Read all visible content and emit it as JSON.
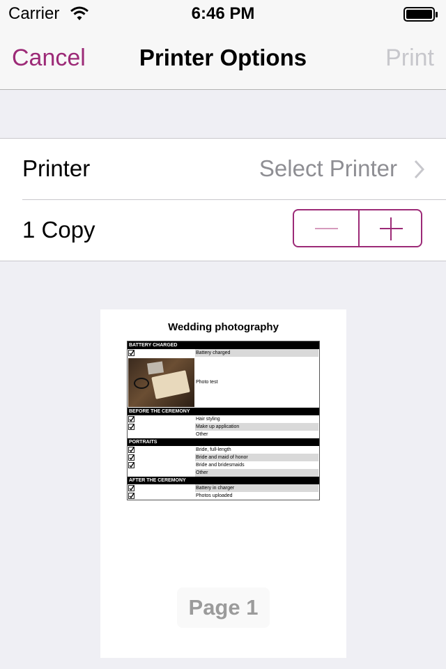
{
  "status_bar": {
    "carrier": "Carrier",
    "time": "6:46 PM"
  },
  "nav": {
    "cancel": "Cancel",
    "title": "Printer Options",
    "print": "Print"
  },
  "printer_row": {
    "label": "Printer",
    "value": "Select Printer"
  },
  "copies_row": {
    "label": "1 Copy"
  },
  "colors": {
    "accent": "#9c2a77",
    "disabled": "#c7c7cc",
    "secondary": "#8e8e93"
  },
  "preview": {
    "title": "Wedding photography",
    "sections": [
      {
        "header": "BATTERY CHARGED",
        "items": [
          "Battery charged"
        ],
        "photo_item": "Photo test"
      },
      {
        "header": "BEFORE THE CEREMONY",
        "items": [
          "Hair styling",
          "Make up application",
          "Other"
        ]
      },
      {
        "header": "PORTRAITS",
        "items": [
          "Bride, full-length",
          "Bride and maid of honor",
          "Bride and bridesmaids",
          "Other"
        ]
      },
      {
        "header": "AFTER THE CEREMONY",
        "items": [
          "Battery in charger",
          "Photos uploaded"
        ]
      }
    ],
    "page_label": "Page 1"
  }
}
